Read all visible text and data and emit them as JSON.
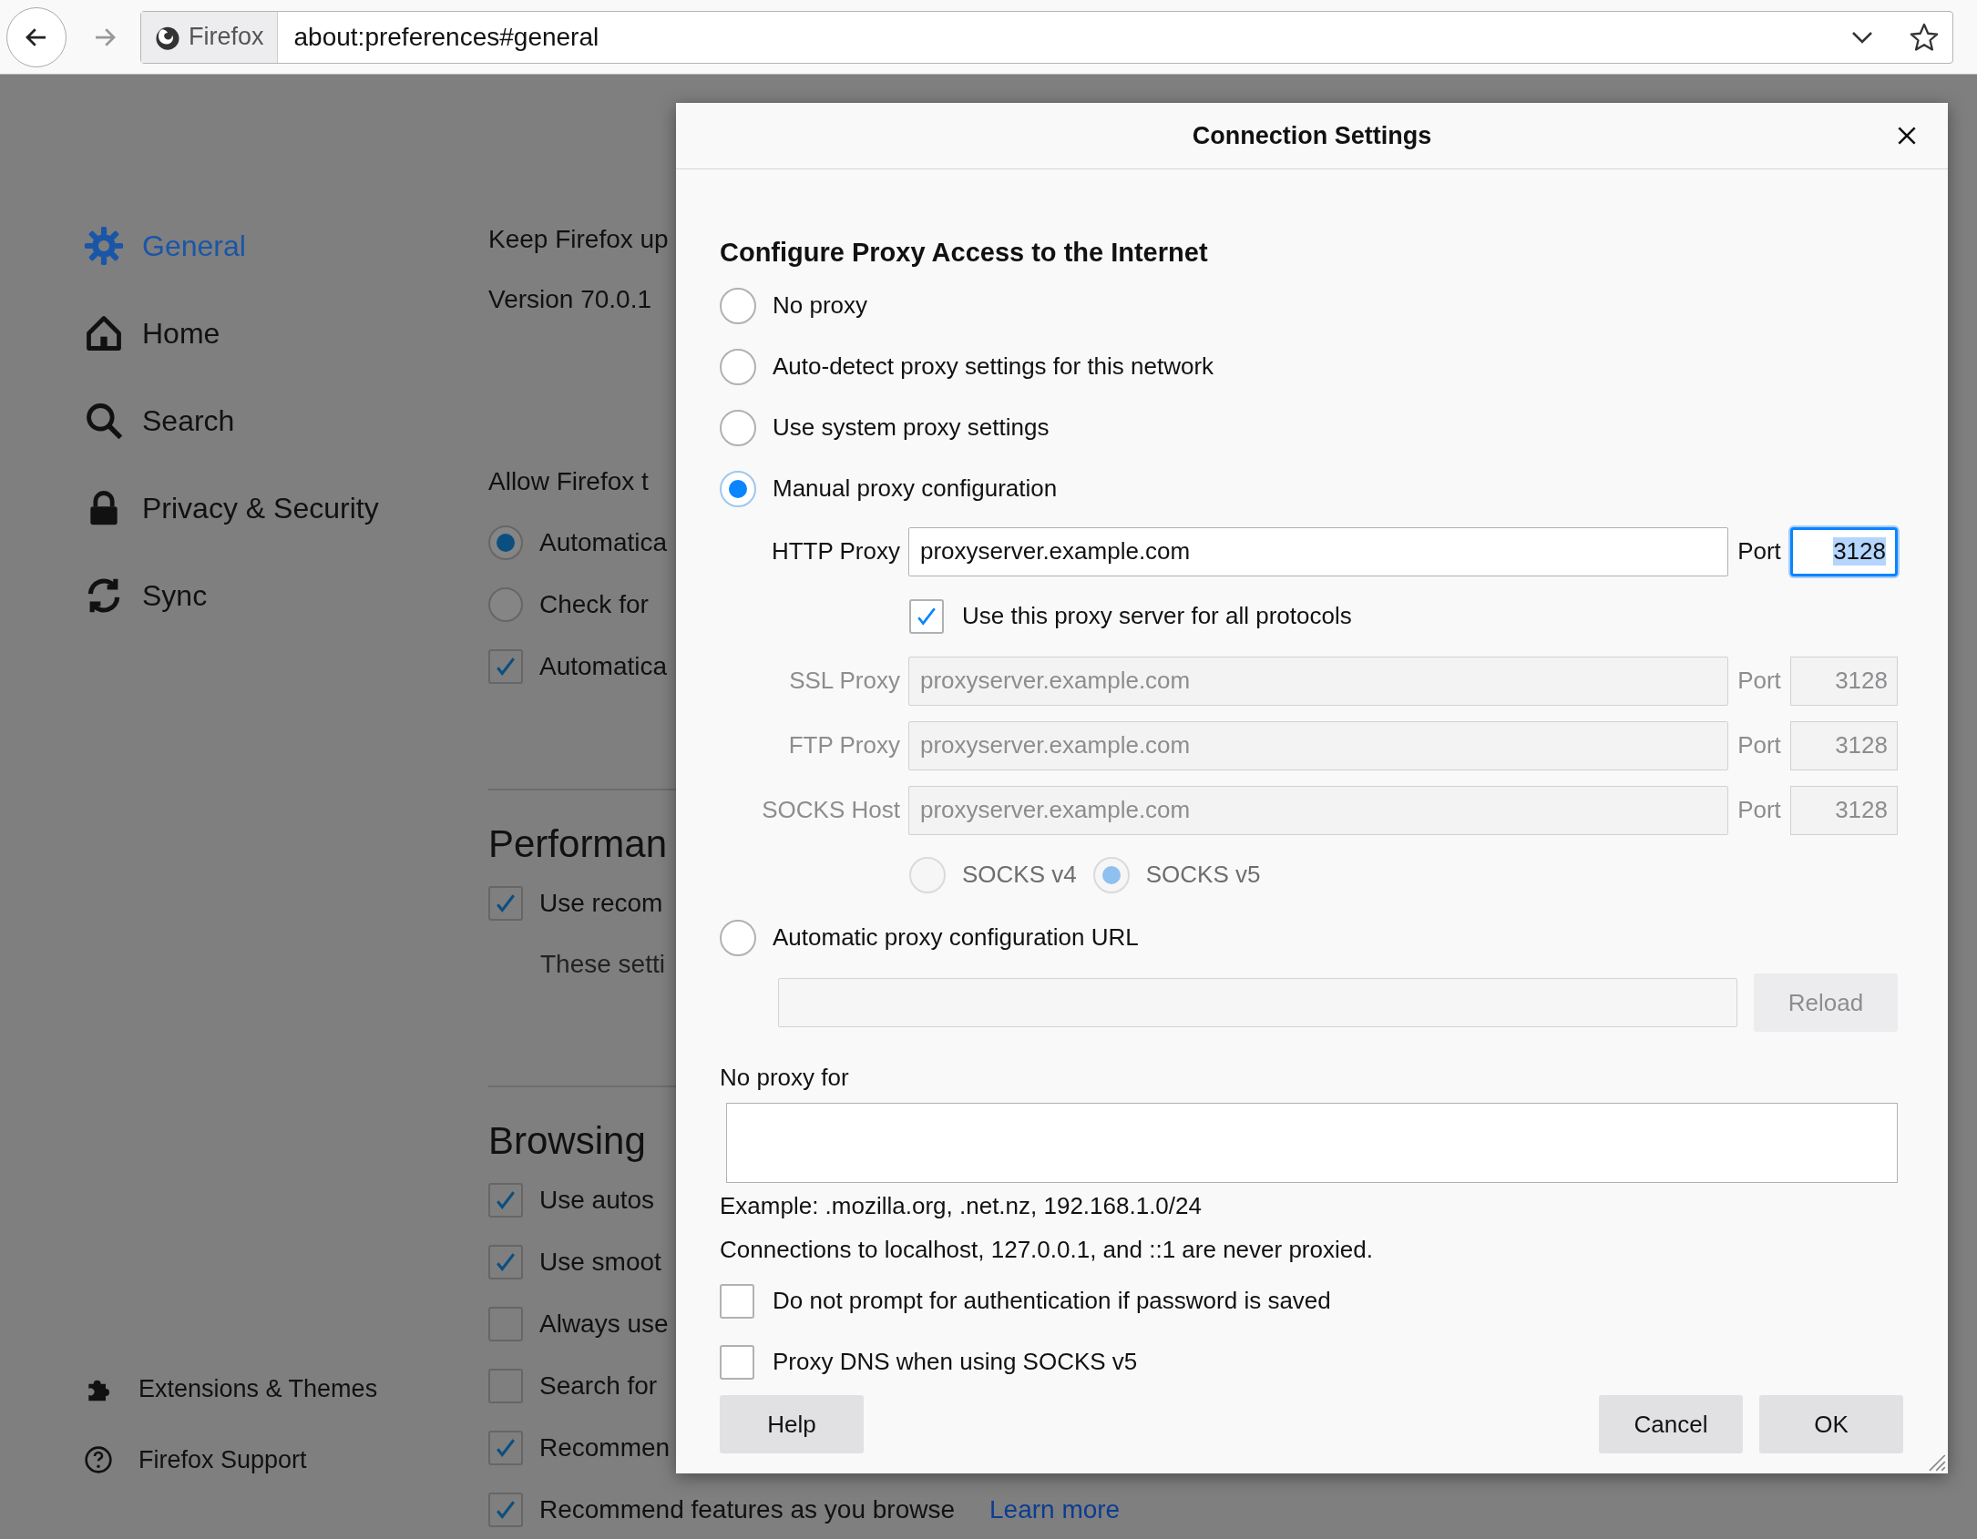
{
  "browser": {
    "identity": "Firefox",
    "url": "about:preferences#general"
  },
  "sidebar": {
    "items": [
      {
        "kind": "gear",
        "label": "General",
        "selected": true
      },
      {
        "kind": "home",
        "label": "Home",
        "selected": false
      },
      {
        "kind": "search",
        "label": "Search",
        "selected": false
      },
      {
        "kind": "lock",
        "label": "Privacy & Security",
        "selected": false
      },
      {
        "kind": "sync",
        "label": "Sync",
        "selected": false
      }
    ],
    "footer": [
      {
        "kind": "puzzle",
        "label": "Extensions & Themes"
      },
      {
        "kind": "help",
        "label": "Firefox Support"
      }
    ]
  },
  "page": {
    "items": [
      {
        "kind": "text",
        "text": "Keep Firefox up"
      },
      {
        "kind": "text",
        "text": "Version 70.0.1"
      },
      {
        "kind": "group",
        "text": "Allow Firefox t"
      },
      {
        "kind": "radio",
        "text": "Automatica",
        "selected": true
      },
      {
        "kind": "radio",
        "text": "Check for",
        "selected": false
      },
      {
        "kind": "checkbox",
        "text": "Automatica",
        "checked": true
      },
      {
        "kind": "heading",
        "text": "Performan"
      },
      {
        "kind": "checkbox",
        "text": "Use recom",
        "checked": true
      },
      {
        "kind": "note",
        "text": "These setti"
      },
      {
        "kind": "heading",
        "text": "Browsing"
      },
      {
        "kind": "checkbox",
        "text": "Use autos",
        "checked": true
      },
      {
        "kind": "checkbox",
        "text": "Use smoot",
        "checked": true
      },
      {
        "kind": "checkbox",
        "text": "Always use",
        "checked": false
      },
      {
        "kind": "checkbox",
        "text": "Search for",
        "checked": false
      },
      {
        "kind": "checkbox",
        "text": "Recommen",
        "checked": true
      },
      {
        "kind": "checkbox",
        "text": "Recommend features as you browse",
        "checked": true,
        "link": "Learn more"
      }
    ]
  },
  "dialog": {
    "title": "Connection Settings",
    "heading": "Configure Proxy Access to the Internet",
    "modes": [
      {
        "kind": "none",
        "label": "No proxy",
        "selected": false
      },
      {
        "kind": "detect",
        "label": "Auto-detect proxy settings for this network",
        "selected": false
      },
      {
        "kind": "system",
        "label": "Use system proxy settings",
        "selected": false
      },
      {
        "kind": "manual",
        "label": "Manual proxy configuration",
        "selected": true
      },
      {
        "kind": "pac",
        "label": "Automatic proxy configuration URL",
        "selected": false
      }
    ],
    "manual": {
      "http": {
        "label": "HTTP Proxy",
        "value": "proxyserver.example.com",
        "port_label": "Port",
        "port": "3128",
        "focused": true
      },
      "share": {
        "label": "Use this proxy server for all protocols",
        "checked": true
      },
      "others": [
        {
          "label": "SSL Proxy",
          "value": "proxyserver.example.com",
          "port_label": "Port",
          "port": "3128",
          "disabled": true
        },
        {
          "label": "FTP Proxy",
          "value": "proxyserver.example.com",
          "port_label": "Port",
          "port": "3128",
          "disabled": true
        },
        {
          "label": "SOCKS Host",
          "value": "proxyserver.example.com",
          "port_label": "Port",
          "port": "3128",
          "disabled": true
        }
      ],
      "socks_versions": [
        {
          "label": "SOCKS v4",
          "selected": false,
          "disabled": true
        },
        {
          "label": "SOCKS v5",
          "selected": true,
          "disabled": true
        }
      ]
    },
    "pac": {
      "disabled": true,
      "reload": "Reload"
    },
    "no_proxy_label": "No proxy for",
    "example": "Example: .mozilla.org, .net.nz, 192.168.1.0/24",
    "note": "Connections to localhost, 127.0.0.1, and ::1 are never proxied.",
    "options": [
      {
        "label": "Do not prompt for authentication if password is saved",
        "checked": false
      },
      {
        "label": "Proxy DNS when using SOCKS v5",
        "checked": false
      }
    ],
    "buttons": {
      "help": "Help",
      "cancel": "Cancel",
      "ok": "OK"
    }
  }
}
